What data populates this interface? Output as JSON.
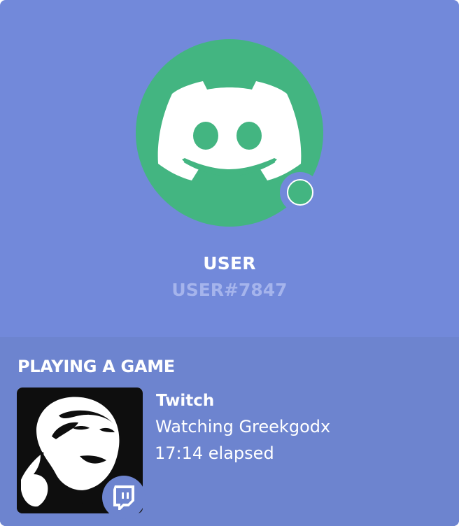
{
  "profile": {
    "username": "USER",
    "tag": "USER#7847",
    "avatar_icon": "discord-logo-icon",
    "status": "online",
    "colors": {
      "background": "#7289da",
      "avatar": "#43b581",
      "status_online": "#43b581",
      "tag_text": "#a5b4ec"
    }
  },
  "activity": {
    "section_title": "PLAYING A GAME",
    "game_name": "Twitch",
    "details": "Watching Greekgodx",
    "elapsed": "17:14 elapsed",
    "badge_icon": "twitch-icon",
    "colors": {
      "background": "#6d84cf"
    }
  }
}
